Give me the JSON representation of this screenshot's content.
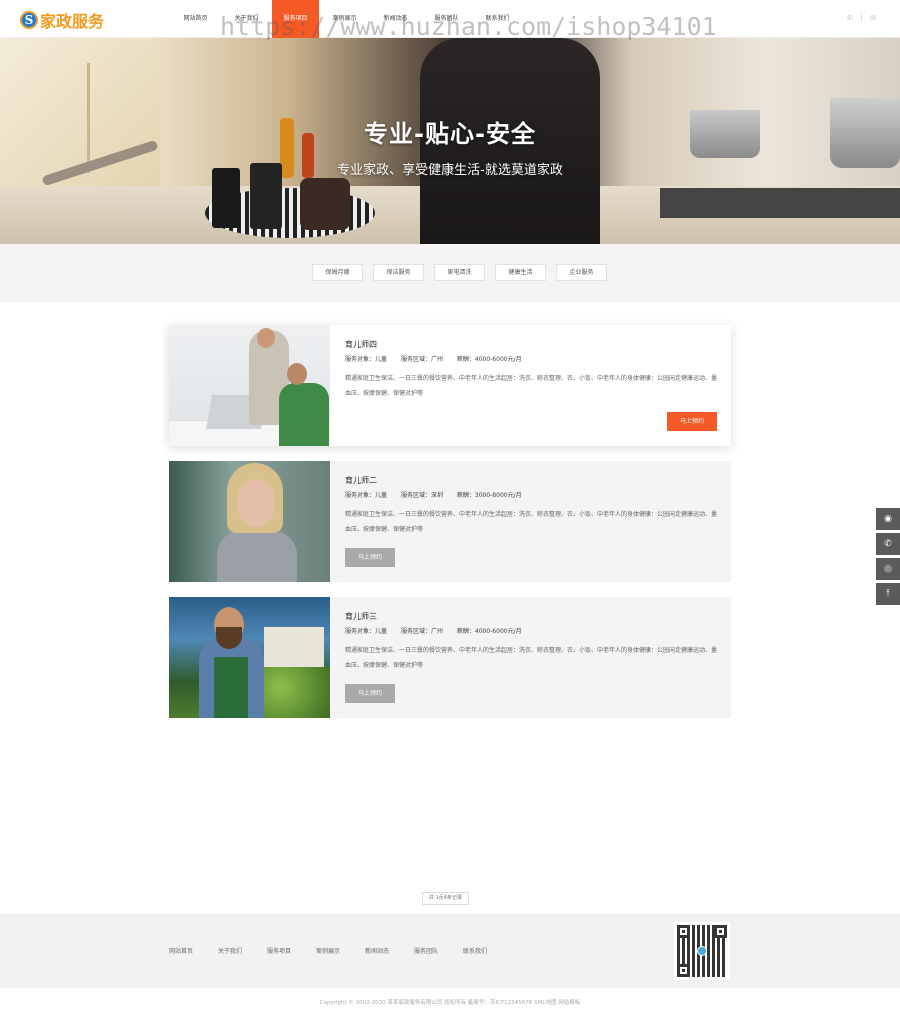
{
  "header": {
    "logo_text": "家政服务",
    "nav": [
      "网站首页",
      "关于我们",
      "服务项目",
      "案例展示",
      "新闻动态",
      "服务团队",
      "联系我们"
    ],
    "active_nav_index": 2,
    "accent_color": "#f55a26"
  },
  "watermark": "https://www.huzhan.com/ishop34101",
  "banner": {
    "title": "专业-贴心-安全",
    "subtitle": "专业家政、享受健康生活-就选莫道家政"
  },
  "categories": [
    "保姆月嫂",
    "保洁服务",
    "家电清洗",
    "健康生活",
    "企业服务"
  ],
  "cards": [
    {
      "title": "育儿师四",
      "service_target": "服务对象：儿童",
      "service_area": "服务区域：广州",
      "salary": "薪酬：4000-6000元/月",
      "desc": "精通家庭卫生保洁、一日三餐的餐饮营养、中老年人的生活起居：洗衣、晾衣整理、衣、小饭、中老年人的身体健康：公园闲走健康运动、量血压、按摩保健、保健对护等",
      "button": "马上预约"
    },
    {
      "title": "育儿师二",
      "service_target": "服务对象：儿童",
      "service_area": "服务区域：深圳",
      "salary": "薪酬：3000-8000元/月",
      "desc": "精通家庭卫生保洁、一日三餐的餐饮营养、中老年人的生活起居：洗衣、晾衣整理、衣、小饭、中老年人的身体健康：公园闲走健康运动、量血压、按摩保健、保健对护等",
      "button": "马上预约"
    },
    {
      "title": "育儿师三",
      "service_target": "服务对象：儿童",
      "service_area": "服务区域：广州",
      "salary": "薪酬：4000-6000元/月",
      "desc": "精通家庭卫生保洁、一日三餐的餐饮营养、中老年人的生活起居：洗衣、晾衣整理、衣、小饭、中老年人的身体健康：公园闲走健康运动、量血压、按摩保健、保健对护等",
      "button": "马上预约"
    }
  ],
  "pager": "共 1页4条记录",
  "footer": {
    "links": [
      "网站首页",
      "关于我们",
      "服务项目",
      "案例展示",
      "新闻动态",
      "服务团队",
      "联系我们"
    ],
    "copyright": "Copyright © 2002-2020 某某家政服务有限公司 版权所有 备案号：苏ICP12345678 XML地图 网站模板"
  },
  "side_tools": [
    "qq-icon",
    "phone-icon",
    "wechat-icon",
    "back-to-top-icon"
  ]
}
